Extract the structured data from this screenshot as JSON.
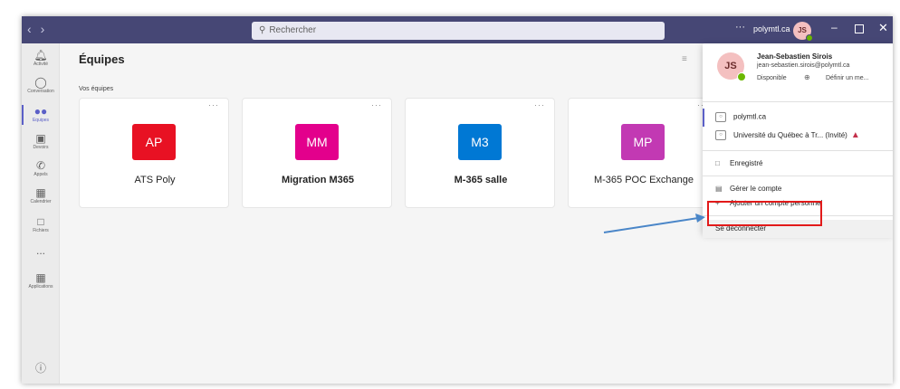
{
  "titlebar": {
    "search_placeholder": "Rechercher",
    "more_icon": "ellipsis-icon",
    "org": "polymtl.ca",
    "avatar_initials": "JS",
    "colors": {
      "bar": "#464775"
    }
  },
  "rail": {
    "items": [
      {
        "label": "Activité",
        "icon": "bell-icon"
      },
      {
        "label": "Conversation",
        "icon": "chat-icon"
      },
      {
        "label": "Équipes",
        "icon": "teams-icon",
        "active": true
      },
      {
        "label": "Devoirs",
        "icon": "assignments-icon"
      },
      {
        "label": "Appels",
        "icon": "phone-icon"
      },
      {
        "label": "Calendrier",
        "icon": "calendar-icon"
      },
      {
        "label": "Fichiers",
        "icon": "file-icon"
      },
      {
        "label": "...",
        "icon": "more-icon"
      },
      {
        "label": "Applications",
        "icon": "apps-icon"
      }
    ],
    "help_icon": "help-icon"
  },
  "main": {
    "title": "Équipes",
    "section_label": "Vos équipes",
    "teams": [
      {
        "initials": "AP",
        "name": "ATS Poly",
        "color": "#e81123",
        "bold": false
      },
      {
        "initials": "MM",
        "name": "Migration M365",
        "color": "#e3008c",
        "bold": true
      },
      {
        "initials": "M3",
        "name": "M-365 salle",
        "color": "#0078d4",
        "bold": true
      },
      {
        "initials": "MP",
        "name": "M-365 POC Exchange",
        "color": "#c239b3",
        "bold": false
      }
    ]
  },
  "account": {
    "initials": "JS",
    "name": "Jean-Sebastien Sirois",
    "email": "jean-sebastien.sirois@polymtl.ca",
    "status": "Disponible",
    "status_message": "Définir un me...",
    "orgs": [
      {
        "name": "polymtl.ca",
        "active": true,
        "warning": false
      },
      {
        "name": "Université du Québec à Tr...  (Invité)",
        "active": false,
        "warning": true
      }
    ],
    "saved": "Enregistré",
    "manage_account": "Gérer le compte",
    "add_personal": "Ajouter un compte personnel",
    "sign_out": "Se déconnecter"
  },
  "annotation": {
    "highlight_color": "#e21a1a",
    "arrow_color": "#4a86c8"
  }
}
